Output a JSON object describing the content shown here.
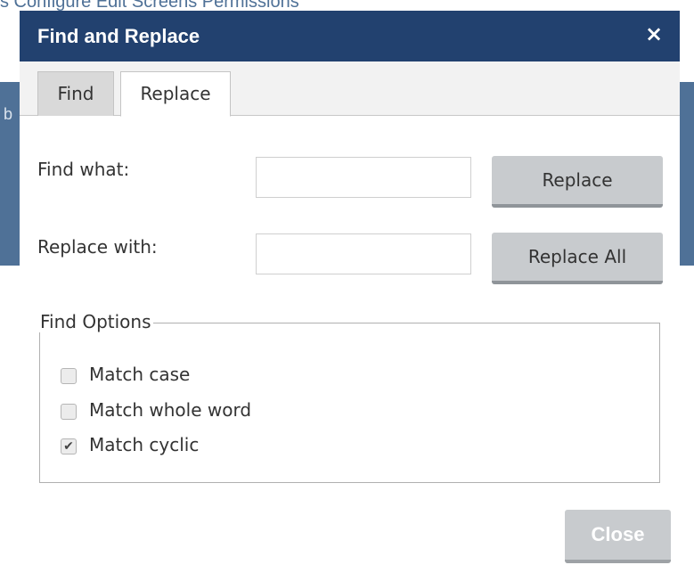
{
  "background": {
    "top_text": "s      Configure  Edit Screens    Permissions",
    "side_char": "b"
  },
  "dialog": {
    "title": "Find and Replace",
    "close_icon": "×"
  },
  "tabs": [
    {
      "label": "Find",
      "selected": false
    },
    {
      "label": "Replace",
      "selected": true
    }
  ],
  "form": {
    "find_what_label": "Find what:",
    "find_what_value": "",
    "replace_with_label": "Replace with:",
    "replace_with_value": ""
  },
  "buttons": {
    "replace": "Replace",
    "replace_all": "Replace All",
    "close": "Close"
  },
  "find_options": {
    "legend": "Find Options",
    "options": [
      {
        "label": "Match case",
        "checked": false
      },
      {
        "label": "Match whole word",
        "checked": false
      },
      {
        "label": "Match cyclic",
        "checked": true
      }
    ]
  },
  "colors": {
    "titlebar": "#22416f",
    "background_band": "#4f7197",
    "button": "#c8cbce"
  }
}
